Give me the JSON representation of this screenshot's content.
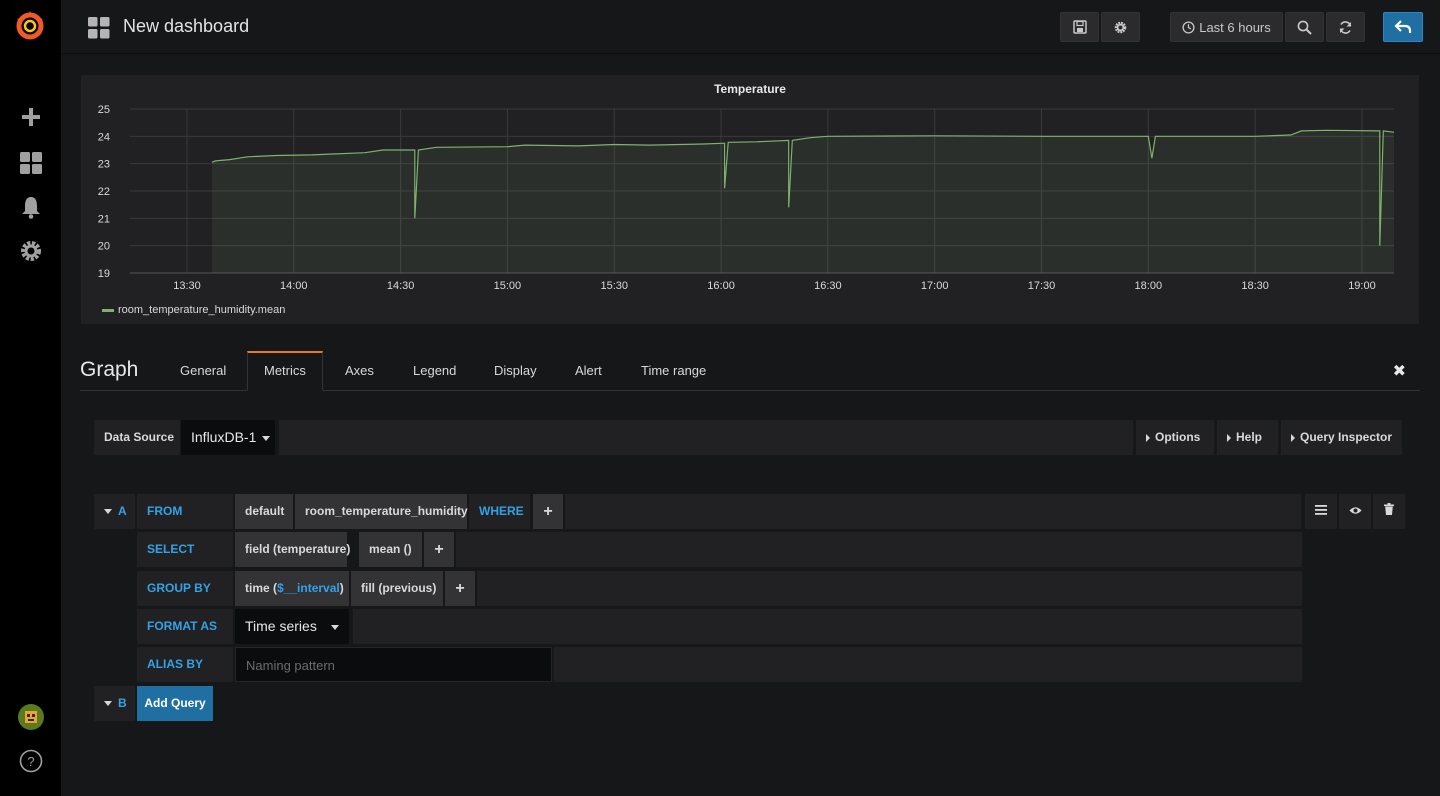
{
  "topbar": {
    "title": "New dashboard",
    "time_range_label": "Last 6 hours",
    "icons": [
      "save-icon",
      "gear-icon",
      "clock-icon",
      "zoom-out-icon",
      "refresh-icon",
      "back-arrow-icon"
    ]
  },
  "sidenav": {
    "icons": [
      "grafana-logo-icon",
      "plus-icon",
      "dashboards-icon",
      "bell-icon",
      "gear-icon",
      "avatar",
      "help-icon"
    ]
  },
  "panel": {
    "legend": "room_temperature_humidity.mean"
  },
  "chart_data": {
    "type": "line",
    "title": "Temperature",
    "xlabel": "",
    "ylabel": "",
    "x_ticks": [
      "13:30",
      "14:00",
      "14:30",
      "15:00",
      "15:30",
      "16:00",
      "16:30",
      "17:00",
      "17:30",
      "18:00",
      "18:30",
      "19:00"
    ],
    "y_ticks": [
      19,
      20,
      21,
      22,
      23,
      24,
      25
    ],
    "ylim": [
      19,
      25
    ],
    "xlim": [
      "13:14",
      "19:09"
    ],
    "grid": true,
    "legend_position": "bottom-left",
    "series": [
      {
        "name": "room_temperature_humidity.mean",
        "color": "#7eb26d",
        "points": [
          [
            "13:37",
            23.05
          ],
          [
            "13:38",
            23.1
          ],
          [
            "13:42",
            23.15
          ],
          [
            "13:47",
            23.25
          ],
          [
            "13:55",
            23.3
          ],
          [
            "14:05",
            23.32
          ],
          [
            "14:10",
            23.35
          ],
          [
            "14:20",
            23.4
          ],
          [
            "14:25",
            23.5
          ],
          [
            "14:34",
            23.5
          ],
          [
            "14:34",
            21.0
          ],
          [
            "14:35",
            23.5
          ],
          [
            "14:40",
            23.6
          ],
          [
            "15:00",
            23.62
          ],
          [
            "15:05",
            23.68
          ],
          [
            "15:20",
            23.65
          ],
          [
            "15:30",
            23.7
          ],
          [
            "15:40",
            23.68
          ],
          [
            "15:55",
            23.72
          ],
          [
            "16:01",
            23.75
          ],
          [
            "16:01",
            22.1
          ],
          [
            "16:02",
            23.78
          ],
          [
            "16:10",
            23.8
          ],
          [
            "16:19",
            23.85
          ],
          [
            "16:19",
            21.4
          ],
          [
            "16:20",
            23.85
          ],
          [
            "16:25",
            23.95
          ],
          [
            "16:30",
            24.0
          ],
          [
            "17:00",
            24.02
          ],
          [
            "17:30",
            24.0
          ],
          [
            "18:00",
            24.0
          ],
          [
            "18:01",
            23.2
          ],
          [
            "18:02",
            24.0
          ],
          [
            "18:30",
            24.0
          ],
          [
            "18:40",
            24.05
          ],
          [
            "18:43",
            24.2
          ],
          [
            "18:50",
            24.22
          ],
          [
            "19:05",
            24.2
          ],
          [
            "19:05",
            20.0
          ],
          [
            "19:06",
            24.2
          ],
          [
            "19:09",
            24.15
          ]
        ]
      }
    ]
  },
  "editor": {
    "title": "Graph",
    "tabs": [
      "General",
      "Metrics",
      "Axes",
      "Legend",
      "Display",
      "Alert",
      "Time range"
    ],
    "active_tab": "Metrics",
    "datasource_label": "Data Source",
    "datasource_value": "InfluxDB-1",
    "options_label": "Options",
    "help_label": "Help",
    "inspector_label": "Query Inspector"
  },
  "query_a": {
    "ref": "A",
    "from_kw": "FROM",
    "policy": "default",
    "measurement": "room_temperature_humidity",
    "where_kw": "WHERE",
    "select_kw": "SELECT",
    "field": "field (temperature)",
    "func": "mean ()",
    "groupby_kw": "GROUP BY",
    "time_prefix": "time (",
    "interval": "$__interval",
    "time_suffix": ")",
    "fill": "fill (previous)",
    "format_kw": "FORMAT AS",
    "format_value": "Time series",
    "alias_kw": "ALIAS BY",
    "alias_placeholder": "Naming pattern"
  },
  "query_b": {
    "ref": "B",
    "add_label": "Add Query"
  },
  "plus": "+"
}
